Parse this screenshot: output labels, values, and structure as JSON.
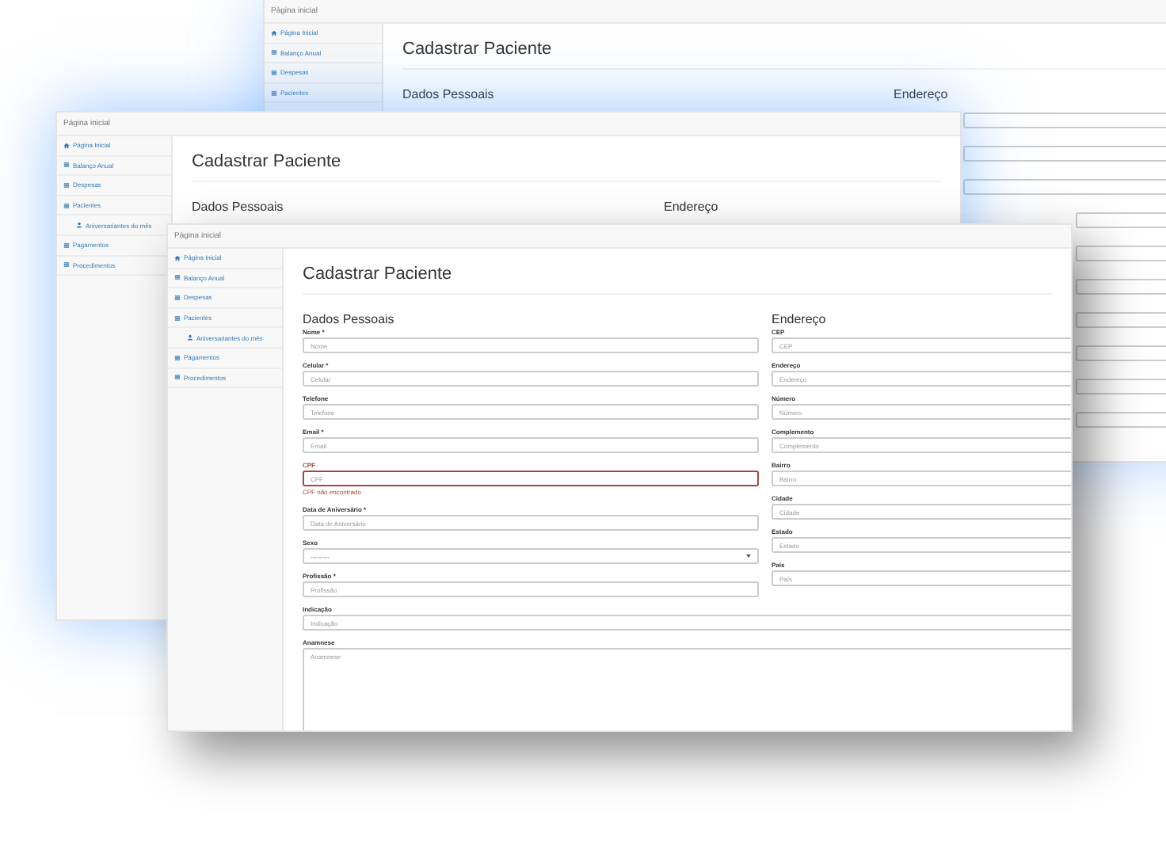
{
  "windows": [
    {
      "navbar_title": "Página inicial",
      "sidebar": [
        {
          "label": "Página Inicial"
        },
        {
          "label": "Balanço Anual"
        },
        {
          "label": "Despesas"
        },
        {
          "label": "Pacientes"
        }
      ],
      "title": "Cadastrar Paciente",
      "personal_heading": "Dados Pessoais",
      "address_heading": "Endereço"
    },
    {
      "navbar_title": "Página inicial",
      "sidebar": [
        {
          "label": "Página Inicial"
        },
        {
          "label": "Balanço Anual"
        },
        {
          "label": "Despesas"
        },
        {
          "label": "Pacientes",
          "children": [
            {
              "label": "Aniversariantes do mês"
            }
          ]
        },
        {
          "label": "Pagamentos"
        },
        {
          "label": "Procedimentos"
        }
      ],
      "title": "Cadastrar Paciente",
      "personal_heading": "Dados Pessoais",
      "address_heading": "Endereço"
    },
    {
      "navbar_title": "Página inicial",
      "sidebar": [
        {
          "label": "Página Inicial"
        },
        {
          "label": "Balanço Anual"
        },
        {
          "label": "Despesas"
        },
        {
          "label": "Pacientes",
          "children": [
            {
              "label": "Aniversariantes do mês"
            }
          ]
        },
        {
          "label": "Pagamentos"
        },
        {
          "label": "Procedimentos"
        }
      ],
      "title": "Cadastrar Paciente",
      "personal_heading": "Dados Pessoais",
      "address_heading": "Endereço",
      "personal_fields": [
        {
          "kind": "input",
          "label": "Nome *",
          "placeholder": "Nome",
          "error": false
        },
        {
          "kind": "input",
          "label": "Celular *",
          "placeholder": "Celular",
          "error": false
        },
        {
          "kind": "input",
          "label": "Telefone",
          "placeholder": "Telefone",
          "error": false
        },
        {
          "kind": "input",
          "label": "Email *",
          "placeholder": "Email",
          "error": false
        },
        {
          "kind": "input",
          "label": "CPF",
          "placeholder": "CPF",
          "error": true,
          "error_text": "CPF não encontrado"
        },
        {
          "kind": "input",
          "label": "Data de Aniversário *",
          "placeholder": "Data de Aniversário",
          "error": false
        },
        {
          "kind": "select",
          "label": "Sexo",
          "value": "---------",
          "error": false
        },
        {
          "kind": "input",
          "label": "Profissão *",
          "placeholder": "Profissão",
          "error": false
        }
      ],
      "full_fields": [
        {
          "kind": "input",
          "label": "Indicação",
          "placeholder": "Indicação",
          "error": false
        },
        {
          "kind": "textarea",
          "label": "Anamnese",
          "placeholder": "Anamnese",
          "error": false
        }
      ],
      "address_fields": [
        {
          "kind": "input",
          "label": "CEP",
          "placeholder": "CEP",
          "error": false
        },
        {
          "kind": "input",
          "label": "Endereço",
          "placeholder": "Endereço",
          "error": false
        },
        {
          "kind": "input",
          "label": "Número",
          "placeholder": "Número",
          "error": false
        },
        {
          "kind": "input",
          "label": "Complemento",
          "placeholder": "Complemento",
          "error": false
        },
        {
          "kind": "input",
          "label": "Bairro",
          "placeholder": "Bairro",
          "error": false
        },
        {
          "kind": "input",
          "label": "Cidade",
          "placeholder": "Cidade",
          "error": false
        },
        {
          "kind": "input",
          "label": "Estado",
          "placeholder": "Estado",
          "error": false
        },
        {
          "kind": "input",
          "label": "País",
          "placeholder": "País",
          "error": false
        }
      ]
    }
  ]
}
